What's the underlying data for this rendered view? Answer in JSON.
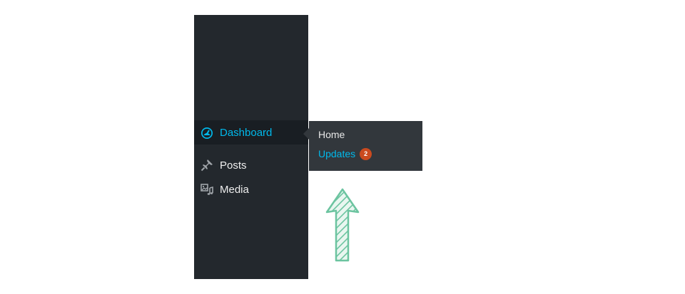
{
  "menu": {
    "items": [
      {
        "label": "Dashboard",
        "icon": "dashboard-icon",
        "active": true
      },
      {
        "label": "Posts",
        "icon": "pin-icon",
        "active": false
      },
      {
        "label": "Media",
        "icon": "media-icon",
        "active": false
      }
    ]
  },
  "flyout": {
    "items": [
      {
        "label": "Home"
      },
      {
        "label": "Updates",
        "badge": "2"
      }
    ]
  },
  "colors": {
    "sidebar_bg": "#23282d",
    "active_bg": "#191e23",
    "flyout_bg": "#32373c",
    "accent": "#00b9eb",
    "badge": "#ca4a1f",
    "arrow": "#6cc4a0"
  }
}
